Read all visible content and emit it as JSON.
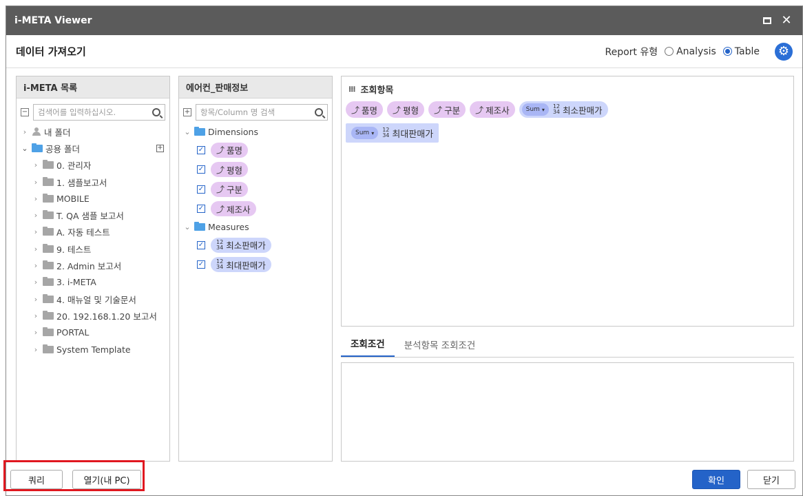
{
  "window": {
    "title": "i-META Viewer"
  },
  "header": {
    "heading": "데이터 가져오기",
    "report_type_label": "Report 유형",
    "options": [
      {
        "label": "Analysis",
        "selected": false
      },
      {
        "label": "Table",
        "selected": true
      }
    ]
  },
  "meta_panel": {
    "title": "i-META 목록",
    "search_placeholder": "검색어를 입력하십시오.",
    "my_folder": "내 폴더",
    "shared_folder": "공용 폴더",
    "folders": [
      "0. 관리자",
      "1. 샘플보고서",
      "MOBILE",
      "T. QA 샘플 보고서",
      "A. 자동 테스트",
      "9. 테스트",
      "2. Admin 보고서",
      "3. i-META",
      "4. 매뉴얼 및 기술문서",
      "20. 192.168.1.20 보고서",
      "PORTAL",
      "System Template"
    ]
  },
  "field_panel": {
    "title": "에어컨_판매정보",
    "search_placeholder": "항목/Column 명 검색",
    "dimensions_label": "Dimensions",
    "dimensions": [
      "품명",
      "평형",
      "구분",
      "제조사"
    ],
    "measures_label": "Measures",
    "measures": [
      "최소판매가",
      "최대판매가"
    ]
  },
  "selection_panel": {
    "title": "조회항목",
    "dims": [
      "품명",
      "평형",
      "구분",
      "제조사"
    ],
    "measures": [
      {
        "agg": "Sum",
        "label": "최소판매가"
      },
      {
        "agg": "Sum",
        "label": "최대판매가"
      }
    ]
  },
  "condition_tabs": [
    "조회조건",
    "분석항목 조회조건"
  ],
  "footer": {
    "query": "쿼리",
    "open_local": "열기(내 PC)",
    "confirm": "확인",
    "close": "닫기"
  },
  "colors": {
    "accent": "#2463c8",
    "dimension_chip": "#e6c8f2",
    "measure_chip": "#cdd6fb",
    "highlight": "#e0171f"
  }
}
